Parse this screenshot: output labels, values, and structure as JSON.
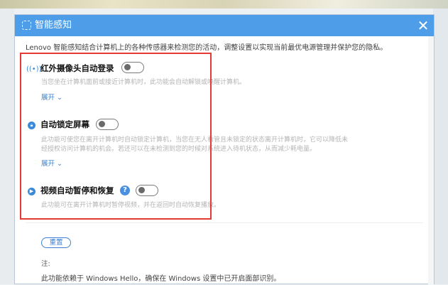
{
  "window": {
    "title": "智能感知",
    "close_glyph": "✕"
  },
  "intro": "Lenovo 智能感知结合计算机上的各种传感器来检测您的活动，调整设置以实现当前最优电源管理并保护您的隐私。",
  "features": [
    {
      "title": "红外摄像头自动登录",
      "icon": "infrared-icon",
      "enabled": false,
      "desc_lines": [
        "当您坐在计算机面前或接近计算机时，此功能会自动解锁或唤醒计算机。"
      ],
      "expand_label": "展开 ⌄"
    },
    {
      "title": "自动锁定屏幕",
      "icon": "lock-icon",
      "enabled": false,
      "desc_lines": [
        "此功能可使您在离开计算机时自动锁定计算机，当您在无人看管且未锁定的状态离开计算机时，它可以降低未",
        "经授权访问计算机的机会。若还可以在未检测到您的时候对系统进入待机状态，从而减少耗电量。"
      ],
      "expand_label": "展开 ⌄"
    },
    {
      "title": "视频自动暂停和恢复",
      "icon": "play-icon",
      "enabled": false,
      "help": "?",
      "desc_lines": [
        "此功能可在离开计算机时暂停视频，并在返回时自动恢复播放。"
      ]
    }
  ],
  "reset_label": "重置",
  "note_label": "注:",
  "note_text": "此功能依赖于 Windows Hello，确保在 Windows 设置中已开启面部识别。",
  "colors": {
    "titlebar": "#4e9de8",
    "highlight": "#e53935",
    "link": "#3b7fcc"
  }
}
